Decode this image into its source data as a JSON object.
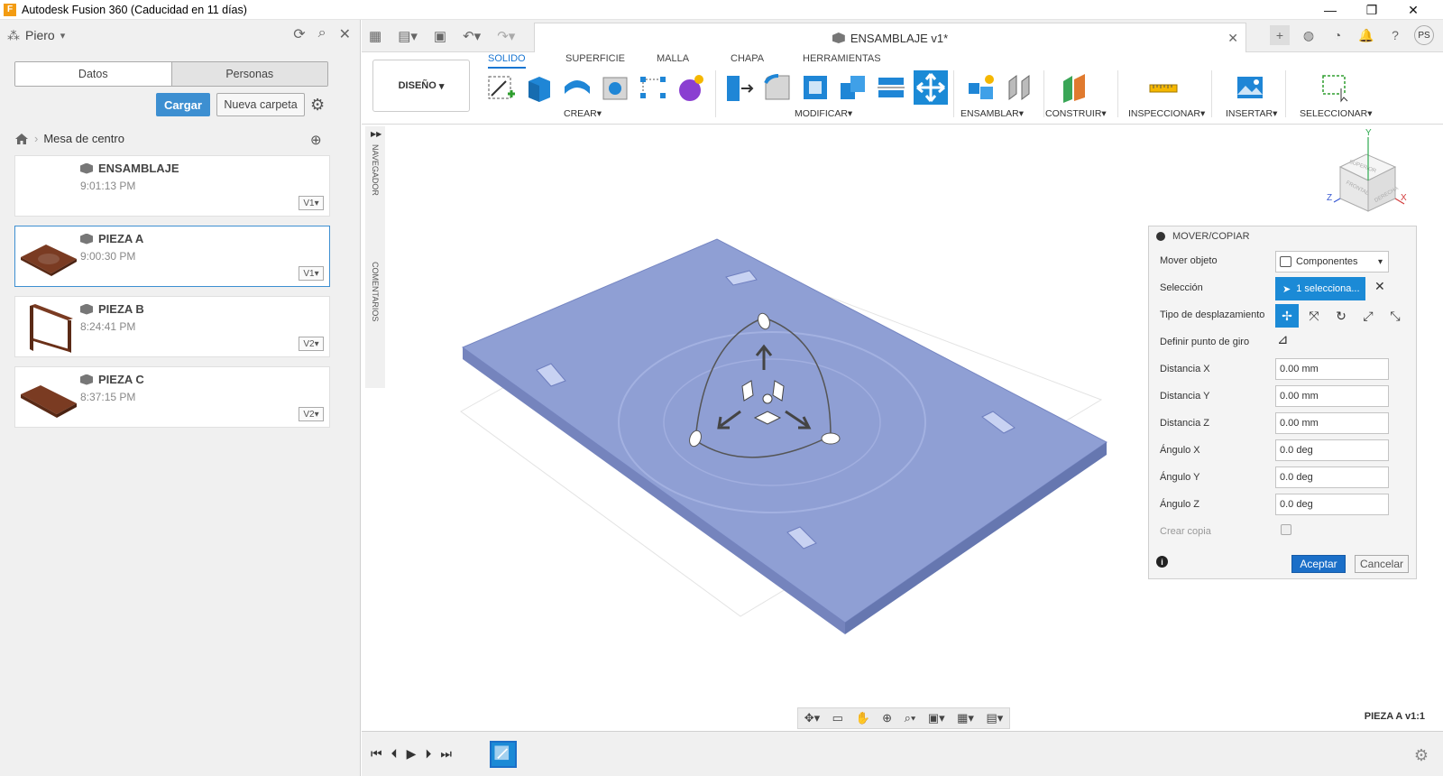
{
  "window": {
    "title": "Autodesk Fusion 360 (Caducidad en 11 días)",
    "controls": {
      "minimize": "—",
      "restore": "❐",
      "close": "✕"
    }
  },
  "left_panel": {
    "user": "Piero",
    "tabs": [
      "Datos",
      "Personas"
    ],
    "upload_label": "Cargar",
    "new_folder_label": "Nueva carpeta",
    "breadcrumb": "Mesa de centro",
    "files": [
      {
        "name": "ENSAMBLAJE",
        "time": "9:01:13 PM",
        "version": "V1"
      },
      {
        "name": "PIEZA A",
        "time": "9:00:30 PM",
        "version": "V1"
      },
      {
        "name": "PIEZA B",
        "time": "8:24:41 PM",
        "version": "V2"
      },
      {
        "name": "PIEZA C",
        "time": "8:37:15 PM",
        "version": "V2"
      }
    ]
  },
  "document_tab": {
    "title": "ENSAMBLAJE v1*"
  },
  "user_initials": "PS",
  "ribbon": {
    "workspace": "DISEÑO",
    "tabs": [
      "SOLIDO",
      "SUPERFICIE",
      "MALLA",
      "CHAPA",
      "HERRAMIENTAS"
    ],
    "groups": [
      "CREAR",
      "MODIFICAR",
      "ENSAMBLAR",
      "CONSTRUIR",
      "INSPECCIONAR",
      "INSERTAR",
      "SELECCIONAR"
    ]
  },
  "side_tabs": {
    "navigator": "NAVEGADOR",
    "comments": "COMENTARIOS"
  },
  "viewcube": {
    "top": "SUPERIOR",
    "front": "FRONTAL",
    "right": "DERECHA",
    "x": "X",
    "y": "Y",
    "z": "Z"
  },
  "dialog": {
    "title": "MOVER/COPIAR",
    "move_object_label": "Mover objeto",
    "move_object_value": "Componentes",
    "selection_label": "Selección",
    "selection_value": "1 selecciona...",
    "move_type_label": "Tipo de desplazamiento",
    "pivot_label": "Definir punto de giro",
    "fields": [
      {
        "label": "Distancia X",
        "value": "0.00 mm"
      },
      {
        "label": "Distancia Y",
        "value": "0.00 mm"
      },
      {
        "label": "Distancia Z",
        "value": "0.00 mm"
      },
      {
        "label": "Ángulo X",
        "value": "0.0 deg"
      },
      {
        "label": "Ángulo Y",
        "value": "0.0 deg"
      },
      {
        "label": "Ángulo Z",
        "value": "0.0 deg"
      }
    ],
    "create_copy_label": "Crear copia",
    "ok_label": "Aceptar",
    "cancel_label": "Cancelar"
  },
  "status_text": "PIEZA A v1:1",
  "colors": {
    "accent": "#1b8ad6",
    "plate": "#8f9fd4",
    "ribbon_active": "#1976d2"
  }
}
